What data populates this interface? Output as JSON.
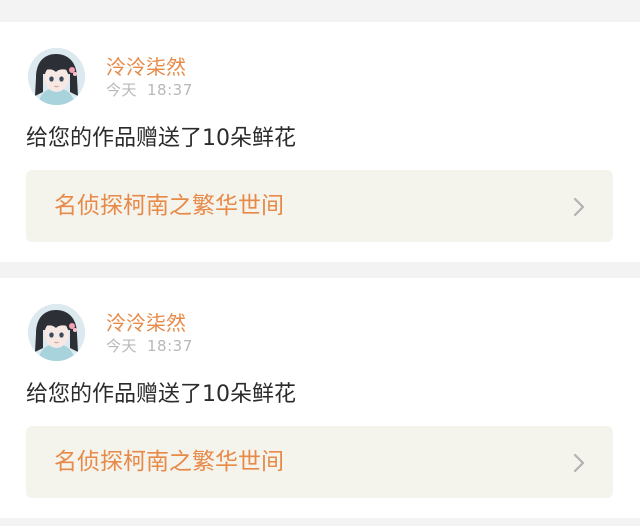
{
  "feed": {
    "items": [
      {
        "user_name": "泠泠柒然",
        "time_day": "今天",
        "time_clock": "18:37",
        "action": "给您的作品赠送了10朵鲜花",
        "work_title": "名侦探柯南之繁华世间",
        "avatar_icon": "anime-girl-avatar",
        "chevron_icon": "chevron-right-icon"
      },
      {
        "user_name": "泠泠柒然",
        "time_day": "今天",
        "time_clock": "18:37",
        "action": "给您的作品赠送了10朵鲜花",
        "work_title": "名侦探柯南之繁华世间",
        "avatar_icon": "anime-girl-avatar",
        "chevron_icon": "chevron-right-icon"
      }
    ]
  },
  "colors": {
    "accent": "#e78a48",
    "page_background": "#f3f3f3",
    "card_background": "#ffffff",
    "link_card_background": "#f4f3ec",
    "muted_text": "#b8b8b8",
    "body_text": "#2b2b2b"
  }
}
